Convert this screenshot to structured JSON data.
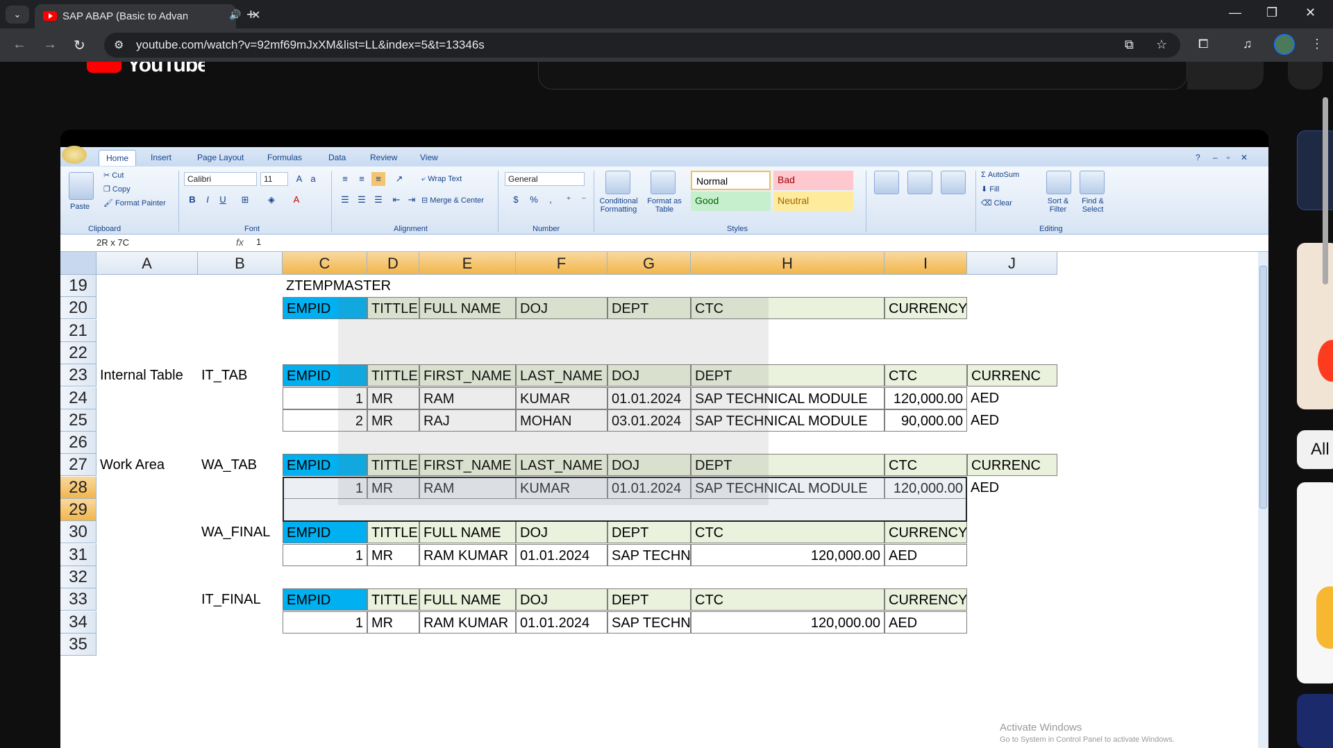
{
  "browser": {
    "tab_title": "SAP ABAP (Basic to Advanc",
    "url": "youtube.com/watch?v=92mf69mJxXM&list=LL&index=5&t=13346s"
  },
  "youtube": {
    "logo_text": "YouTube",
    "side_card_text": "All"
  },
  "excel": {
    "tabs": [
      "Home",
      "Insert",
      "Page Layout",
      "Formulas",
      "Data",
      "Review",
      "View"
    ],
    "clipboard": {
      "paste": "Paste",
      "cut": "Cut",
      "copy": "Copy",
      "format_painter": "Format Painter",
      "label": "Clipboard"
    },
    "font": {
      "name": "Calibri",
      "size": "11",
      "label": "Font"
    },
    "alignment": {
      "wrap_text": "Wrap Text",
      "merge_center": "Merge & Center",
      "label": "Alignment"
    },
    "number": {
      "format": "General",
      "label": "Number"
    },
    "styles": {
      "conditional": "Conditional Formatting",
      "format_table": "Format as Table",
      "normal": "Normal",
      "bad": "Bad",
      "good": "Good",
      "neutral": "Neutral",
      "label": "Styles"
    },
    "cells": {
      "r19": {
        "c": "ZTEMPMASTER"
      },
      "r20": [
        "EMPID",
        "TITTLE",
        "FULL NAME",
        "DOJ",
        "DEPT",
        "CTC",
        "CURRENCY"
      ],
      "r23": {
        "a": "Internal Table",
        "b": "IT_TAB",
        "hdr": [
          "EMPID",
          "TITTLE",
          "FIRST_NAME",
          "LAST_NAME",
          "DOJ",
          "DEPT",
          "CTC",
          "CURRENC"
        ]
      },
      "r24": [
        "1",
        "MR",
        "RAM",
        "KUMAR",
        "01.01.2024",
        "SAP TECHNICAL MODULE",
        "120,000.00",
        "AED"
      ],
      "r25": [
        "2",
        "MR",
        "RAJ",
        "MOHAN",
        "03.01.2024",
        "SAP TECHNICAL MODULE",
        "90,000.00",
        "AED"
      ],
      "r27": {
        "a": "Work Area",
        "b": "WA_TAB",
        "hdr": [
          "EMPID",
          "TITTLE",
          "FIRST_NAME",
          "LAST_NAME",
          "DOJ",
          "DEPT",
          "CTC",
          "CURRENC"
        ]
      },
      "r28": [
        "1",
        "MR",
        "RAM",
        "KUMAR",
        "01.01.2024",
        "SAP TECHNICAL MODULE",
        "120,000.00",
        "AED"
      ],
      "r30": {
        "b": "WA_FINAL",
        "hdr": [
          "EMPID",
          "TITTLE",
          "FULL NAME",
          "DOJ",
          "DEPT",
          "CTC",
          "CURRENCY"
        ]
      },
      "r31": [
        "1",
        "MR",
        "RAM KUMAR",
        "01.01.2024",
        "SAP TECHNI",
        "120,000.00",
        "AED"
      ],
      "r33": {
        "b": "IT_FINAL",
        "hdr": [
          "EMPID",
          "TITTLE",
          "FULL NAME",
          "DOJ",
          "DEPT",
          "CTC",
          "CURRENCY"
        ]
      },
      "r34": [
        "1",
        "MR",
        "RAM KUMAR",
        "01.01.2024",
        "SAP TECHNI",
        "120,000.00",
        "AED"
      ]
    },
    "editing": {
      "autosum": "AutoSum",
      "fill": "Fill",
      "clear": "Clear",
      "sort_filter": "Sort & Filter",
      "find_select": "Find & Select",
      "label": "Editing"
    },
    "name_box": "2R x 7C",
    "formula_value": "1",
    "columns": [
      "A",
      "B",
      "C",
      "D",
      "E",
      "F",
      "G",
      "H",
      "I",
      "J"
    ],
    "rows": [
      "19",
      "20",
      "21",
      "22",
      "23",
      "24",
      "25",
      "26",
      "27",
      "28",
      "29",
      "30",
      "31",
      "32",
      "33",
      "34",
      "35"
    ],
    "activate_windows": "Activate Windows",
    "activate_sub": "Go to System in Control Panel to activate Windows."
  },
  "colors": {
    "header_green": "#eaf1dd",
    "empid_blue": "#00b0f0",
    "selected_header": "#f1b64c"
  }
}
